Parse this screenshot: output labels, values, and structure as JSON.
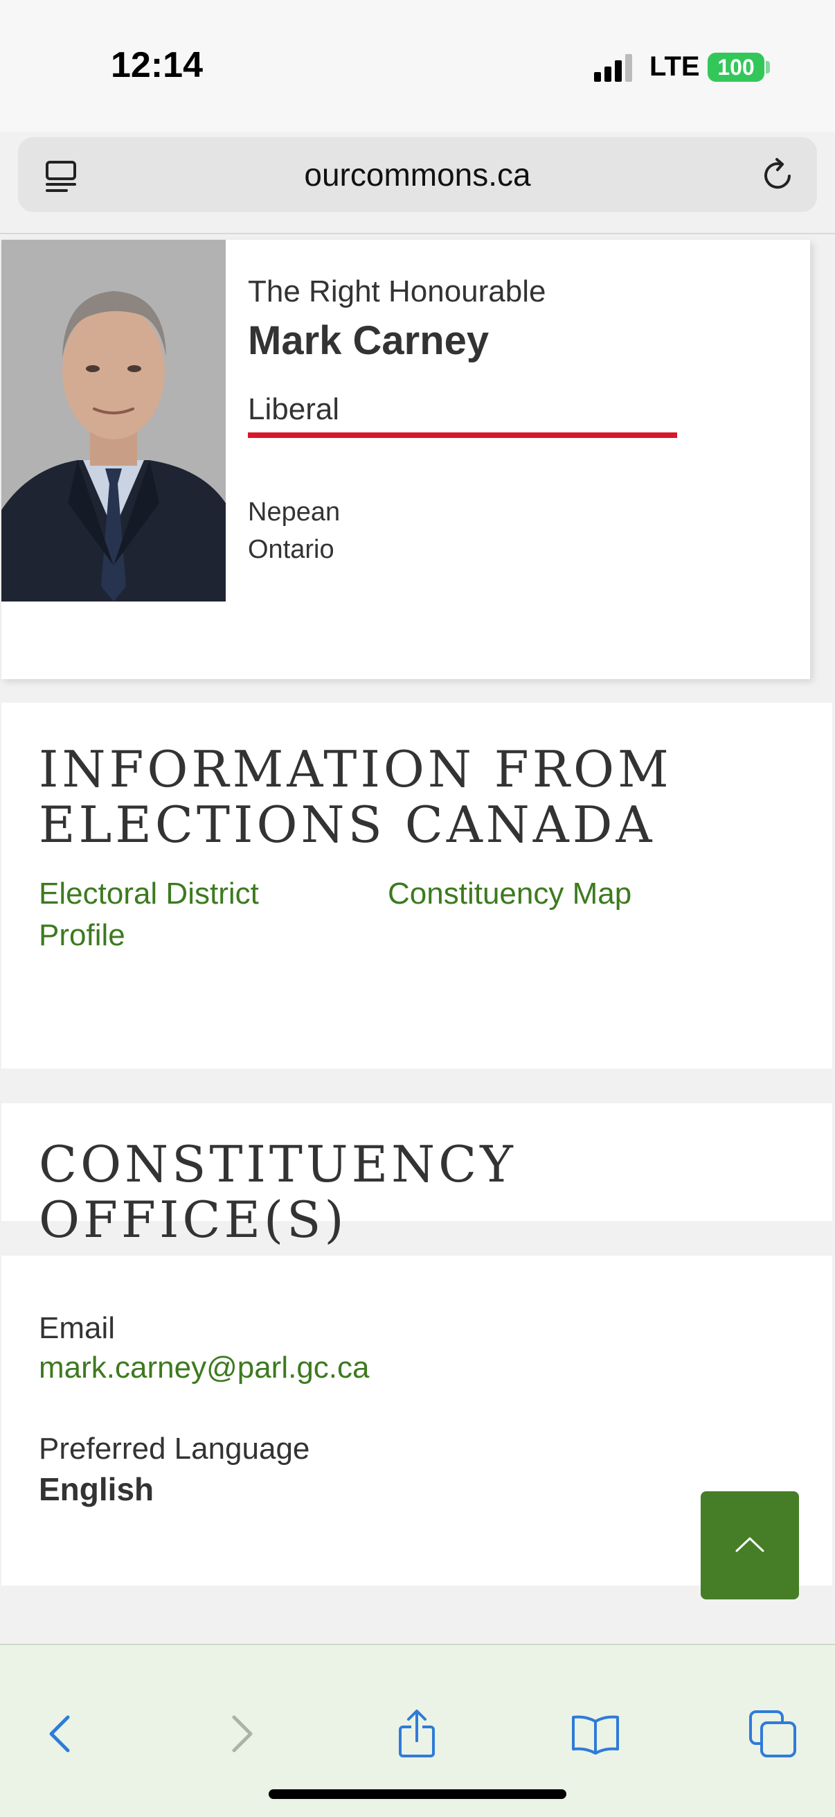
{
  "status_bar": {
    "time": "12:14",
    "network": "LTE",
    "battery": "100",
    "battery_color": "#33c759"
  },
  "browser": {
    "url": "ourcommons.ca",
    "left_icon": "reader-icon",
    "right_icon": "reload-icon"
  },
  "member": {
    "honorific": "The Right Honourable",
    "name": "Mark Carney",
    "party": "Liberal",
    "party_color": "#d7182a",
    "riding": "Nepean",
    "province": "Ontario",
    "photo_icon": "portrait-photo"
  },
  "elections_section": {
    "title_line1": "INFORMATION FROM",
    "title_line2": "ELECTIONS CANADA",
    "link1_line1": "Electoral District",
    "link1_line2": "Profile",
    "link2": "Constituency Map",
    "link_color": "#3d7a1f"
  },
  "constituency_section": {
    "title": "CONSTITUENCY OFFICE(S)"
  },
  "contact_section": {
    "email_label": "Email",
    "email": "mark.carney@parl.gc.ca",
    "language_label": "Preferred Language",
    "language": "English"
  },
  "scroll_top": {
    "icon": "chevron-up-icon",
    "color": "#457e26"
  },
  "toolbar": {
    "icons": [
      "back-icon",
      "forward-icon",
      "share-icon",
      "bookmarks-icon",
      "tabs-icon"
    ]
  }
}
